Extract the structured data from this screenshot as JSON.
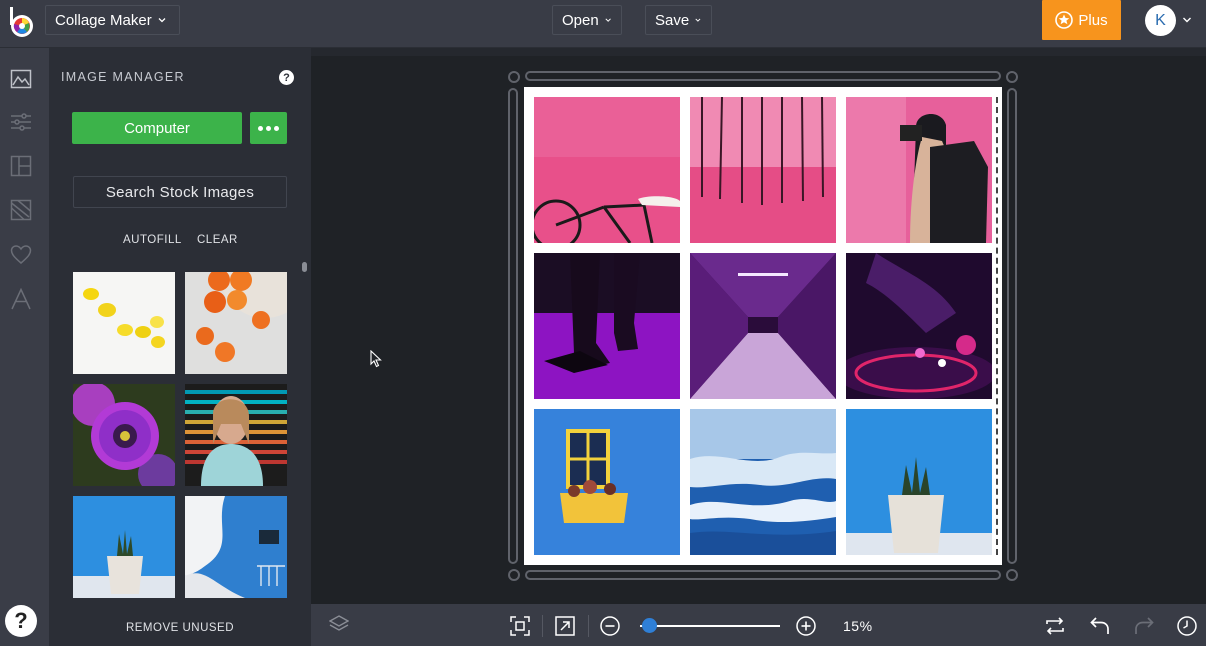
{
  "header": {
    "app_name": "Collage Maker",
    "open_label": "Open",
    "save_label": "Save",
    "plus_label": "Plus",
    "avatar_initial": "K"
  },
  "rail": {
    "icons": [
      "image-icon",
      "sliders-icon",
      "layout-icon",
      "texture-icon",
      "heart-icon",
      "text-icon"
    ],
    "help_label": "?"
  },
  "image_manager": {
    "title": "IMAGE MANAGER",
    "help_label": "?",
    "computer_label": "Computer",
    "search_stock_label": "Search Stock Images",
    "autofill_label": "AUTOFILL",
    "clear_label": "CLEAR",
    "remove_unused_label": "REMOVE UNUSED",
    "thumbnails": [
      "lemons",
      "oranges",
      "purple-flower",
      "woman-striped-light",
      "cactus-pot",
      "blue-wall"
    ]
  },
  "canvas": {
    "cells": [
      "pink-bicycle",
      "pink-fence",
      "photographer-pink",
      "purple-feet",
      "purple-tunnel",
      "dj-turntable",
      "yellow-window",
      "clouds",
      "cactus-blue"
    ]
  },
  "bottom": {
    "zoom_label": "15%",
    "zoom_level": 0.15
  },
  "colors": {
    "accent_green": "#3cb34a",
    "plus_orange": "#f7941d",
    "zoom_blue": "#2f7fd6"
  }
}
